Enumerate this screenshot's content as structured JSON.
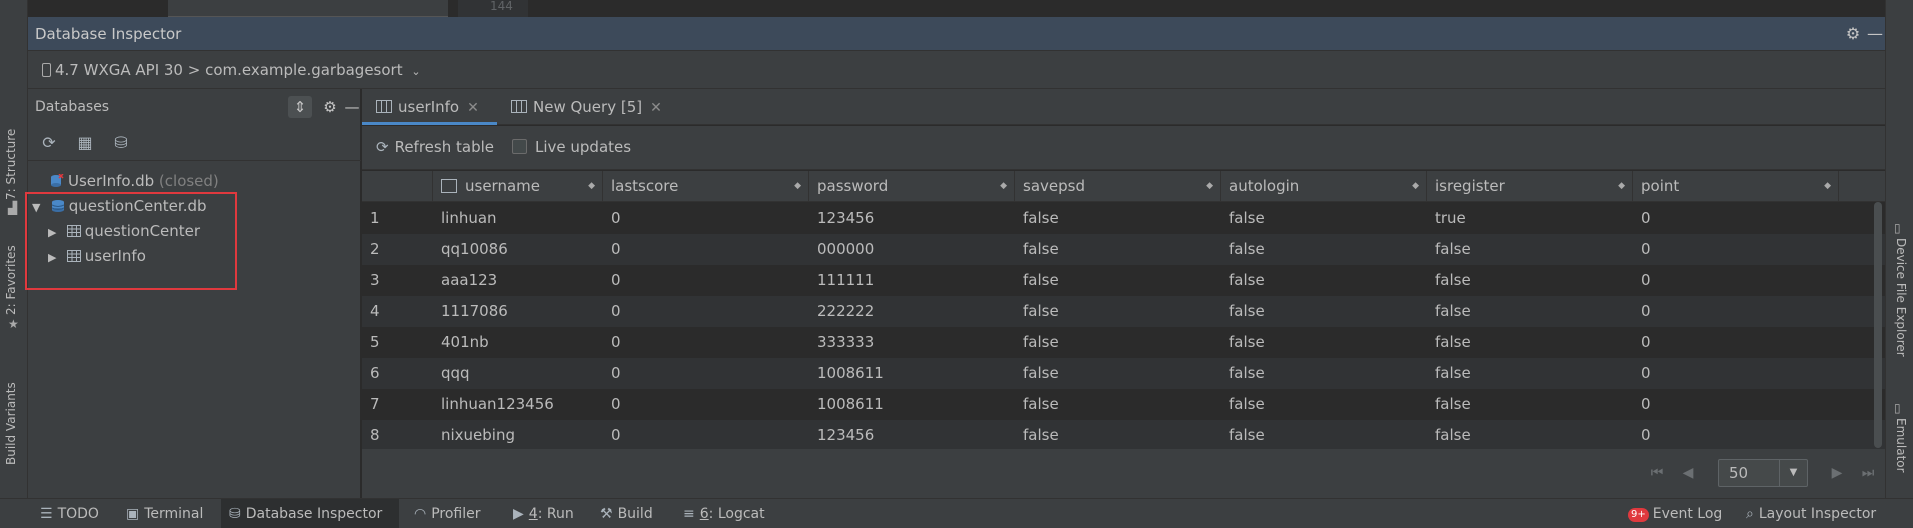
{
  "editor": {
    "line_number": "144"
  },
  "inspector": {
    "title": "Database Inspector"
  },
  "device": {
    "label": "4.7 WXGA API 30 > com.example.garbagesort"
  },
  "databases": {
    "header": "Databases",
    "items": [
      {
        "name": "UserInfo.db",
        "status": "(closed)"
      },
      {
        "name": "questionCenter.db",
        "children": [
          "questionCenter",
          "userInfo"
        ]
      }
    ]
  },
  "tabs": [
    {
      "label": "userInfo",
      "active": true
    },
    {
      "label": "New Query [5]",
      "active": false
    }
  ],
  "toolbar": {
    "refresh_label": "Refresh table",
    "live_updates_label": "Live updates"
  },
  "table": {
    "columns": [
      "username",
      "lastscore",
      "password",
      "savepsd",
      "autologin",
      "isregister",
      "point"
    ],
    "rows": [
      [
        "1",
        "linhuan",
        "0",
        "123456",
        "false",
        "false",
        "true",
        "0"
      ],
      [
        "2",
        "qq10086",
        "0",
        "000000",
        "false",
        "false",
        "false",
        "0"
      ],
      [
        "3",
        "aaa123",
        "0",
        "111111",
        "false",
        "false",
        "false",
        "0"
      ],
      [
        "4",
        "1117086",
        "0",
        "222222",
        "false",
        "false",
        "false",
        "0"
      ],
      [
        "5",
        "401nb",
        "0",
        "333333",
        "false",
        "false",
        "false",
        "0"
      ],
      [
        "6",
        "qqq",
        "0",
        "1008611",
        "false",
        "false",
        "false",
        "0"
      ],
      [
        "7",
        "linhuan123456",
        "0",
        "1008611",
        "false",
        "false",
        "false",
        "0"
      ],
      [
        "8",
        "nixuebing",
        "0",
        "123456",
        "false",
        "false",
        "false",
        "0"
      ]
    ]
  },
  "pager": {
    "page_size": "50"
  },
  "left_stripe": [
    "7: Structure",
    "2: Favorites",
    "Build Variants"
  ],
  "right_stripe": [
    "Device File Explorer",
    "Emulator"
  ],
  "bottom": {
    "todo": "TODO",
    "terminal": "Terminal",
    "db_inspector": "Database Inspector",
    "profiler": "Profiler",
    "run_num": "4",
    "run_label": ": Run",
    "build": "Build",
    "logcat_num": "6",
    "logcat_label": ": Logcat",
    "event_badge": "9+",
    "event_log": "Event Log",
    "layout_inspector": "Layout Inspector"
  },
  "colors": {
    "accent": "#4a88c7",
    "highlight": "#e0393e",
    "header_bg": "#3d4a5a"
  }
}
